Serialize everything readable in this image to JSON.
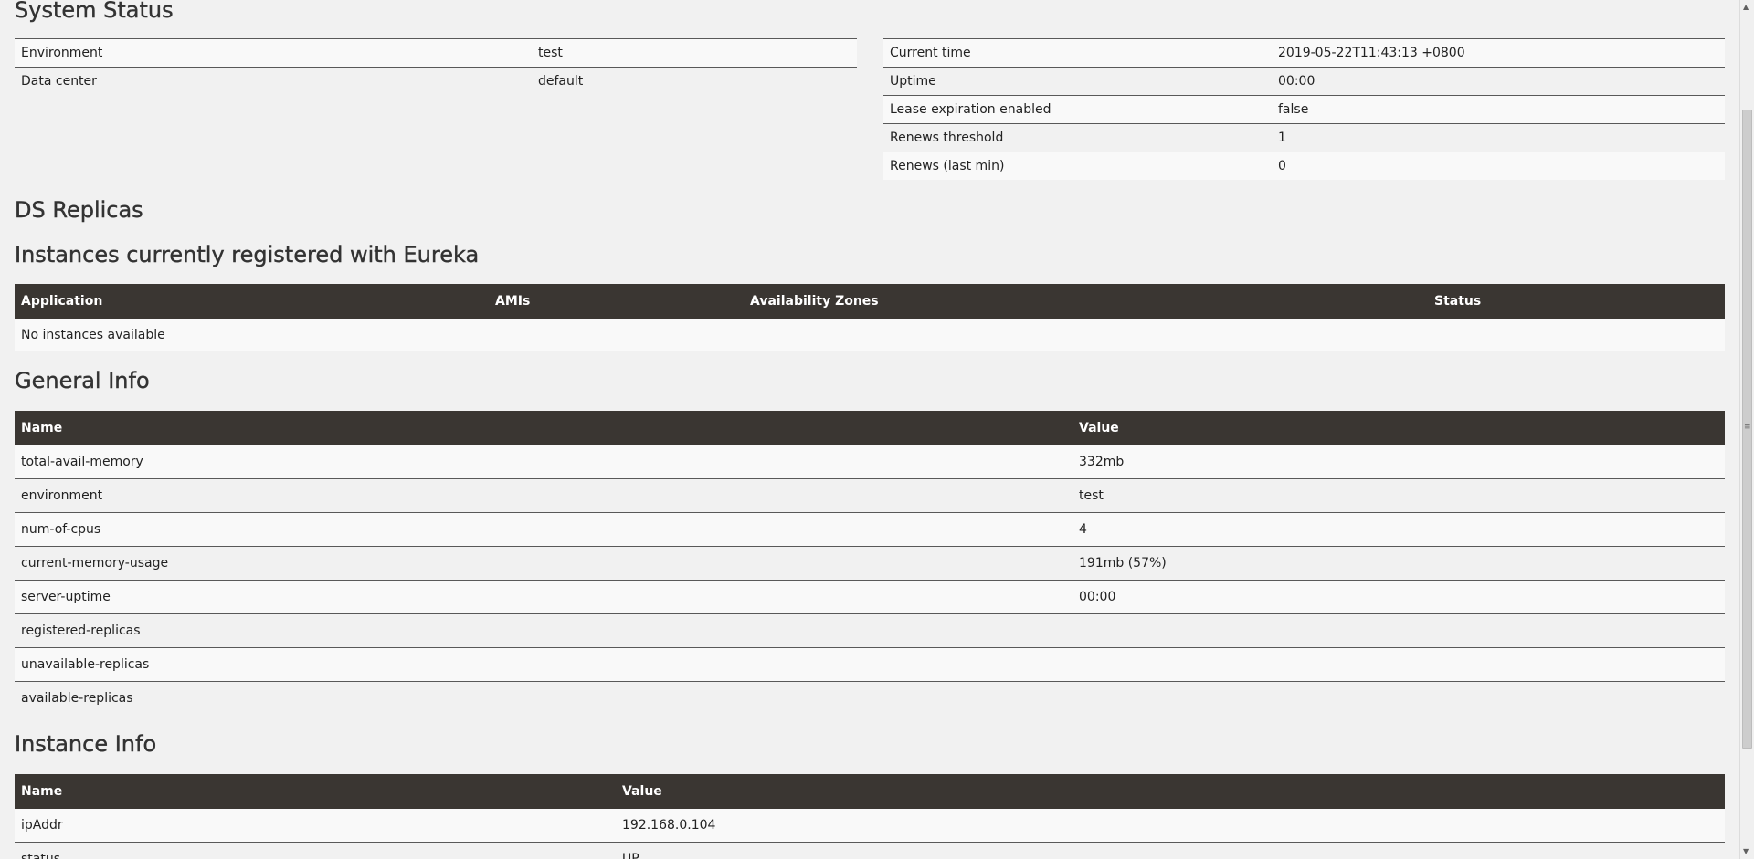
{
  "system_status": {
    "title": "System Status",
    "left_rows": [
      {
        "label": "Environment",
        "value": "test"
      },
      {
        "label": "Data center",
        "value": "default"
      }
    ],
    "right_rows": [
      {
        "label": "Current time",
        "value": "2019-05-22T11:43:13 +0800"
      },
      {
        "label": "Uptime",
        "value": "00:00"
      },
      {
        "label": "Lease expiration enabled",
        "value": "false"
      },
      {
        "label": "Renews threshold",
        "value": "1"
      },
      {
        "label": "Renews (last min)",
        "value": "0"
      }
    ]
  },
  "ds_replicas": {
    "title": "DS Replicas"
  },
  "instances": {
    "title": "Instances currently registered with Eureka",
    "headers": [
      "Application",
      "AMIs",
      "Availability Zones",
      "Status"
    ],
    "empty_text": "No instances available"
  },
  "general_info": {
    "title": "General Info",
    "headers": [
      "Name",
      "Value"
    ],
    "rows": [
      {
        "name": "total-avail-memory",
        "value": "332mb"
      },
      {
        "name": "environment",
        "value": "test"
      },
      {
        "name": "num-of-cpus",
        "value": "4"
      },
      {
        "name": "current-memory-usage",
        "value": "191mb (57%)"
      },
      {
        "name": "server-uptime",
        "value": "00:00"
      },
      {
        "name": "registered-replicas",
        "value": ""
      },
      {
        "name": "unavailable-replicas",
        "value": ""
      },
      {
        "name": "available-replicas",
        "value": ""
      }
    ]
  },
  "instance_info": {
    "title": "Instance Info",
    "headers": [
      "Name",
      "Value"
    ],
    "rows": [
      {
        "name": "ipAddr",
        "value": "192.168.0.104"
      },
      {
        "name": "status",
        "value": "UP"
      }
    ]
  },
  "scrollbar": {
    "up_icon": "arrow-up-icon",
    "down_icon": "arrow-down-icon",
    "grip_icon": "grip-icon"
  }
}
